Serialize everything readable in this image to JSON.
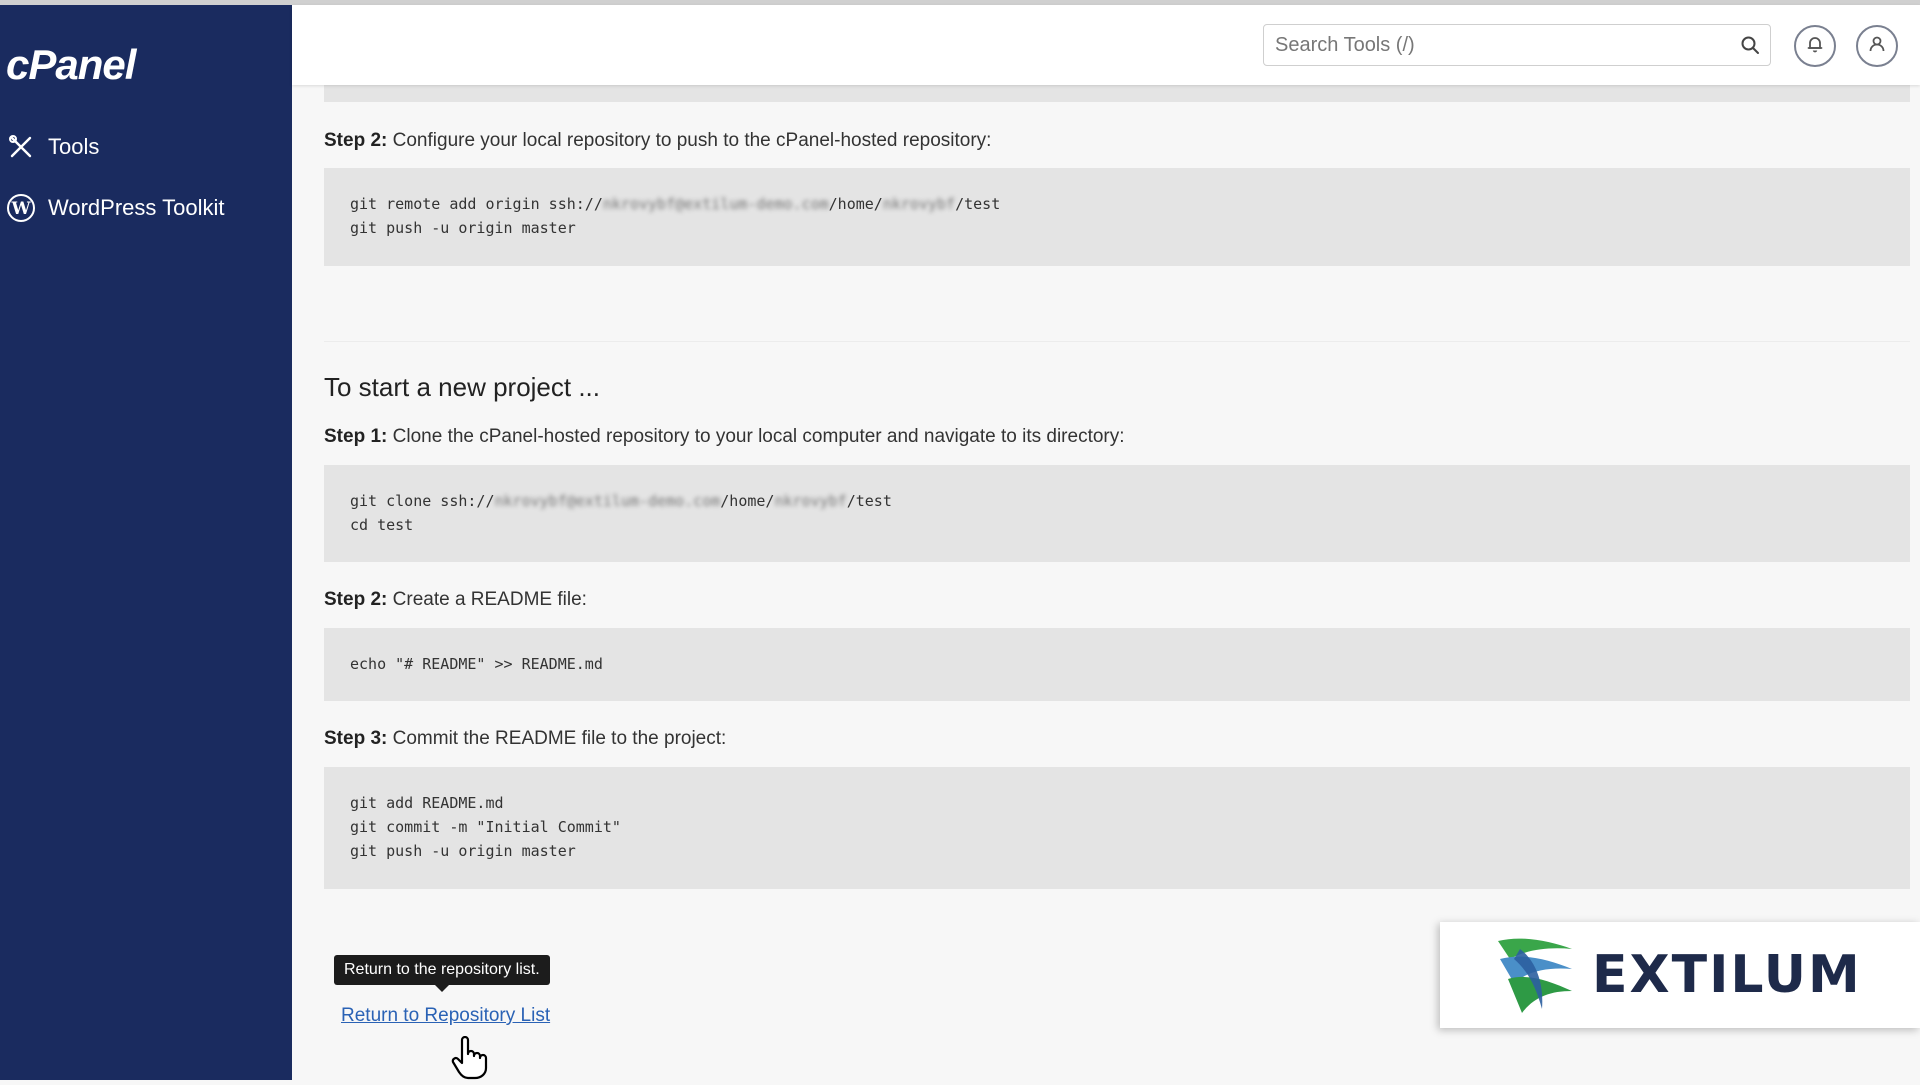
{
  "app": {
    "logo_text": "cPanel"
  },
  "sidebar": {
    "items": [
      {
        "label": "Tools",
        "icon": "tools-icon"
      },
      {
        "label": "WordPress Toolkit",
        "icon": "wordpress-icon"
      }
    ],
    "bg": "#1a2b5f"
  },
  "header": {
    "search_placeholder": "Search Tools (/)",
    "icons": [
      "search-icon",
      "bell-icon",
      "user-icon"
    ]
  },
  "content": {
    "existing_step2": {
      "label": "Step 2:",
      "text": "Configure your local repository to push to the cPanel-hosted repository:",
      "code": {
        "line1_prefix": "git remote add origin ssh://",
        "line1_blur1": "nkrovybf@extilum-demo.com",
        "line1_mid": "/home/",
        "line1_blur2": "nkrovybf",
        "line1_suffix": "/test",
        "line2": "git push -u origin master"
      }
    },
    "new_project": {
      "title": "To start a new project ...",
      "step1": {
        "label": "Step 1:",
        "text": "Clone the cPanel-hosted repository to your local computer and navigate to its directory:",
        "code": {
          "line1_prefix": "git clone ssh://",
          "line1_blur1": "nkrovybf@extilum-demo.com",
          "line1_mid": "/home/",
          "line1_blur2": "nkrovybf",
          "line1_suffix": "/test",
          "line2": "cd test"
        }
      },
      "step2": {
        "label": "Step 2:",
        "text": "Create a README file:",
        "code": {
          "line1": "echo \"# README\" >> README.md"
        }
      },
      "step3": {
        "label": "Step 3:",
        "text": "Commit the README file to the project:",
        "code": {
          "line1": "git add README.md",
          "line2": "git commit -m \"Initial Commit\"",
          "line3": "git push -u origin master"
        }
      }
    },
    "tooltip": "Return to the repository list.",
    "return_link": "Return to Repository List"
  },
  "brand": {
    "name": "EXTILUM",
    "colors": {
      "green": "#3aa64a",
      "blue": "#2c5fa0",
      "text": "#1e2a4a"
    }
  }
}
